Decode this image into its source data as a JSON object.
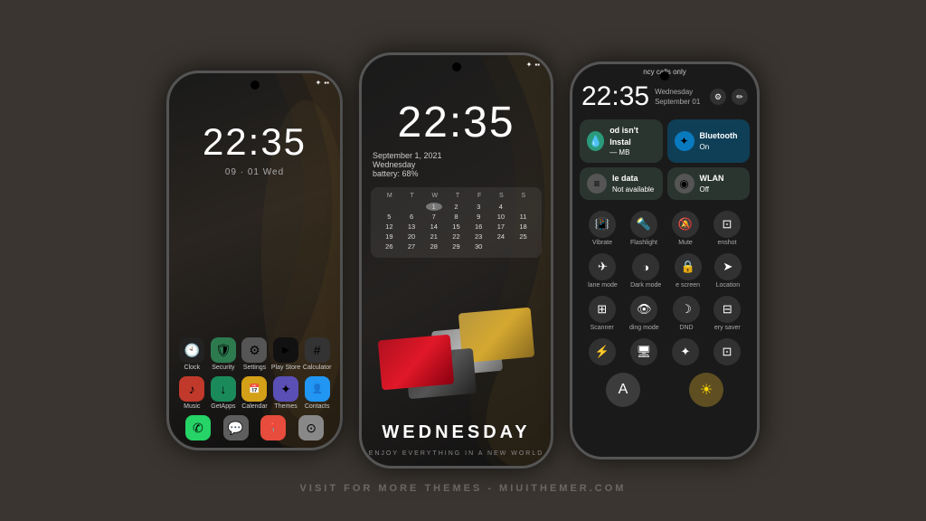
{
  "background": "#3a3530",
  "watermark": "VISIT FOR MORE THEMES - MIUITHEMER.COM",
  "phone1": {
    "statusBar": {
      "bluetooth": "✦",
      "battery": "▪▪▪"
    },
    "clock": "22:35",
    "date": "09 · 01  Wed",
    "apps": [
      {
        "label": "Clock",
        "color": "app-clock",
        "icon": "🕙"
      },
      {
        "label": "Security",
        "color": "app-security",
        "icon": "🛡"
      },
      {
        "label": "Settings",
        "color": "app-settings",
        "icon": "⚙"
      },
      {
        "label": "Play Store",
        "color": "app-playstore",
        "icon": "▶"
      },
      {
        "label": "Calculator",
        "color": "app-calculator",
        "icon": "#"
      }
    ],
    "apps2": [
      {
        "label": "Music",
        "color": "app-music",
        "icon": "♪"
      },
      {
        "label": "GetApps",
        "color": "app-getapps",
        "icon": "↓"
      },
      {
        "label": "Calendar",
        "color": "app-calendar",
        "icon": "📅"
      },
      {
        "label": "Themes",
        "color": "app-themes",
        "icon": "✦"
      },
      {
        "label": "Contacts",
        "color": "app-contacts",
        "icon": "👤"
      }
    ],
    "apps3": [
      {
        "label": "",
        "color": "app-messages",
        "icon": "✆"
      },
      {
        "label": "",
        "color": "app-chat",
        "icon": "💬"
      },
      {
        "label": "",
        "color": "app-maps",
        "icon": "📍"
      },
      {
        "label": "",
        "color": "app-camera",
        "icon": "⊙"
      }
    ]
  },
  "phone2": {
    "clock": "22:35",
    "date": "September 1, 2021",
    "day": "Wednesday",
    "battery": "battery:  68%",
    "calendar": {
      "headers": [
        "M",
        "T",
        "W",
        "T",
        "F",
        "S",
        "S"
      ],
      "rows": [
        [
          "",
          "",
          "1",
          "2",
          "3",
          "4"
        ],
        [
          "5",
          "6",
          "7",
          "8",
          "9",
          "10",
          "11"
        ],
        [
          "12",
          "13",
          "14",
          "15",
          "16",
          "17",
          "18"
        ],
        [
          "19",
          "20",
          "21",
          "22",
          "23",
          "24",
          "25"
        ],
        [
          "26",
          "27",
          "28",
          "29",
          "30",
          "",
          ""
        ]
      ],
      "highlight": "1"
    },
    "wednesday": "WEDNESDAY",
    "sub": "ENJOY EVERYTHING IN A NEW WORLD"
  },
  "phone3": {
    "notification": "ncy calls only",
    "clock": "22:35",
    "dateDay": "Wednesday",
    "dateDate": "September 01",
    "tiles": [
      {
        "icon": "💧",
        "title": "od isn't Instal",
        "sub": "— MB",
        "type": "teal"
      },
      {
        "icon": "✦",
        "title": "Bluetooth",
        "sub": "On",
        "type": "blue"
      }
    ],
    "tiles2": [
      {
        "icon": "≡",
        "title": "le data",
        "sub": "Not available",
        "type": "gray"
      },
      {
        "icon": "◉",
        "title": "WLAN",
        "sub": "Off",
        "type": "gray"
      }
    ],
    "iconRow1": [
      {
        "icon": "📳",
        "label": "Vibrate"
      },
      {
        "icon": "🔦",
        "label": "Flashlight"
      },
      {
        "icon": "🔕",
        "label": "Mute"
      },
      {
        "icon": "⊡",
        "label": "enshot"
      }
    ],
    "iconRow2": [
      {
        "icon": "✈",
        "label": "lane mode"
      },
      {
        "icon": "◑",
        "label": "Dark mode"
      },
      {
        "icon": "🔒",
        "label": "e screen"
      },
      {
        "icon": "➤",
        "label": "Location"
      }
    ],
    "iconRow3": [
      {
        "icon": "⊞",
        "label": "Scanner"
      },
      {
        "icon": "👁",
        "label": "ding mode"
      },
      {
        "icon": "☽",
        "label": "DND"
      },
      {
        "icon": "⊟",
        "label": "ery saver"
      }
    ],
    "iconRow4": [
      {
        "icon": "⚡",
        "label": ""
      },
      {
        "icon": "🖥",
        "label": ""
      },
      {
        "icon": "✦",
        "label": ""
      },
      {
        "icon": "⊡",
        "label": ""
      }
    ],
    "finalButtons": [
      {
        "icon": "A",
        "type": "light"
      },
      {
        "icon": "✦",
        "type": "sun"
      }
    ]
  }
}
